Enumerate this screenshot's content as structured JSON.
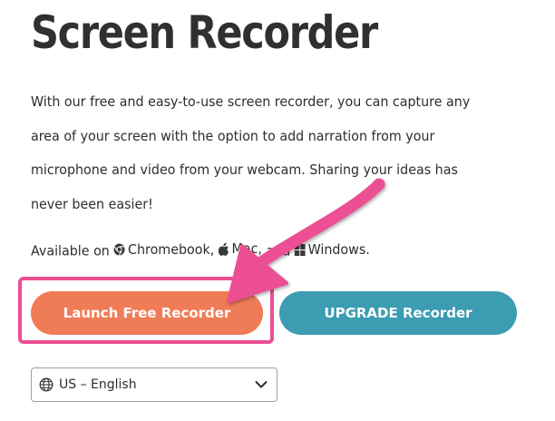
{
  "page": {
    "title": "Screen Recorder",
    "description": "With our free and easy-to-use screen recorder, you can capture any area of your screen with the option to add narration from your microphone and video from your webcam. Sharing your ideas has never been easier!",
    "available_prefix": "Available on",
    "platforms": {
      "chromebook": "Chromebook,",
      "mac": "Mac,",
      "and": "and",
      "windows": "Windows."
    }
  },
  "buttons": {
    "launch_label": "Launch Free Recorder",
    "upgrade_label": "UPGRADE Recorder"
  },
  "language_select": {
    "selected": "US – English"
  },
  "colors": {
    "launch_button": "#f07c57",
    "upgrade_button": "#3c9cb1",
    "annotation": "#ec4f93",
    "title_text": "#303030"
  },
  "icons": {
    "chromebook": "chrome-icon",
    "mac": "apple-icon",
    "windows": "windows-icon",
    "language": "globe-icon",
    "dropdown": "chevron-down-icon"
  }
}
